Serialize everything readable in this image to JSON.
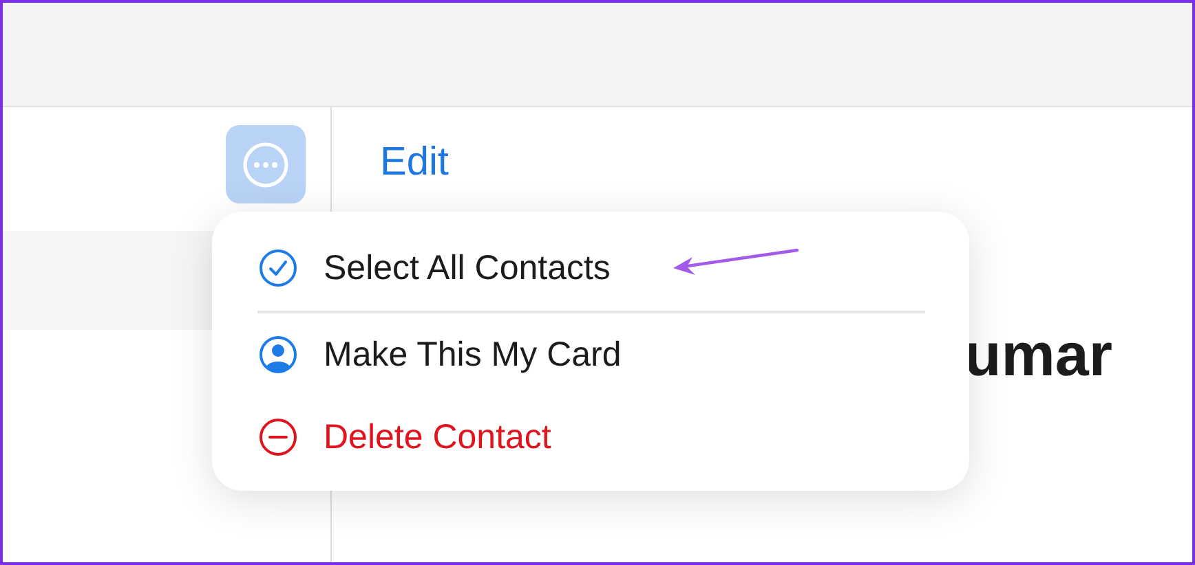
{
  "detail": {
    "edit_button": "Edit",
    "name": "umar"
  },
  "menu": {
    "groups": [
      [
        {
          "label": "Select All Contacts",
          "kind": "check",
          "destructive": false
        }
      ],
      [
        {
          "label": "Make This My Card",
          "kind": "person",
          "destructive": false
        },
        {
          "label": "Delete Contact",
          "kind": "minus",
          "destructive": true
        }
      ]
    ]
  }
}
